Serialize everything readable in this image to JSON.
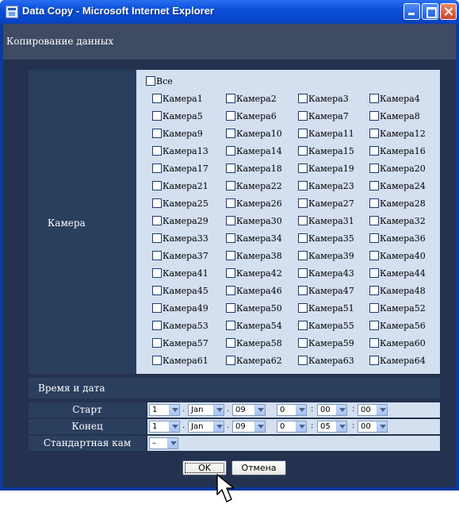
{
  "window": {
    "title": "Data Copy - Microsoft Internet Explorer"
  },
  "header": {
    "title": "Копирование данных"
  },
  "camera": {
    "label": "Камера",
    "all_label": "Все",
    "cameras": [
      "Камера1",
      "Камера2",
      "Камера3",
      "Камера4",
      "Камера5",
      "Камера6",
      "Камера7",
      "Камера8",
      "Камера9",
      "Камера10",
      "Камера11",
      "Камера12",
      "Камера13",
      "Камера14",
      "Камера15",
      "Камера16",
      "Камера17",
      "Камера18",
      "Камера19",
      "Камера20",
      "Камера21",
      "Камера22",
      "Камера23",
      "Камера24",
      "Камера25",
      "Камера26",
      "Камера27",
      "Камера28",
      "Камера29",
      "Камера30",
      "Камера31",
      "Камера32",
      "Камера33",
      "Камера34",
      "Камера35",
      "Камера36",
      "Камера37",
      "Камера38",
      "Камера39",
      "Камера40",
      "Камера41",
      "Камера42",
      "Камера43",
      "Камера44",
      "Камера45",
      "Камера46",
      "Камера47",
      "Камера48",
      "Камера49",
      "Камера50",
      "Камера51",
      "Камера52",
      "Камера53",
      "Камера54",
      "Камера55",
      "Камера56",
      "Камера57",
      "Камера58",
      "Камера59",
      "Камера60",
      "Камера61",
      "Камера62",
      "Камера63",
      "Камера64"
    ]
  },
  "datetime": {
    "label": "Время и дата",
    "start": {
      "label": "Старт",
      "day": "1",
      "month": "Jan",
      "year": "09",
      "hour": "0",
      "minute": "00",
      "second": "00"
    },
    "end": {
      "label": "Конец",
      "day": "1",
      "month": "Jan",
      "year": "09",
      "hour": "0",
      "minute": "05",
      "second": "00"
    }
  },
  "standard_cam": {
    "label": "Стандартная кам",
    "value": "–"
  },
  "separators": {
    "date": ".",
    "time": ":"
  },
  "buttons": {
    "ok": "OK",
    "cancel": "Отмена"
  },
  "colors": {
    "titlebar": "#0a4fd8",
    "panel": "#2a3f5e",
    "grid_bg": "#d4dff0",
    "header": "#3f4a63"
  }
}
